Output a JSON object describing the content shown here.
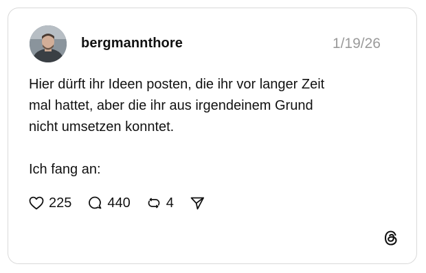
{
  "post": {
    "username": "bergmannthore",
    "date": "1/19/26",
    "text_lines": [
      "Hier dürft ihr Ideen posten, die ihr vor langer Zeit",
      "mal hattet, aber die ihr aus irgendeinem Grund",
      "nicht umsetzen konntet."
    ],
    "text_second": "Ich fang an:"
  },
  "actions": {
    "likes": "225",
    "replies": "440",
    "reposts": "4"
  },
  "icons": {
    "like": "heart-icon",
    "reply": "speech-bubble-icon",
    "repost": "repost-icon",
    "share": "send-icon",
    "brand": "threads-logo-icon"
  },
  "colors": {
    "text": "#111111",
    "muted": "#9a9a9a",
    "border": "#d9d9d9"
  }
}
